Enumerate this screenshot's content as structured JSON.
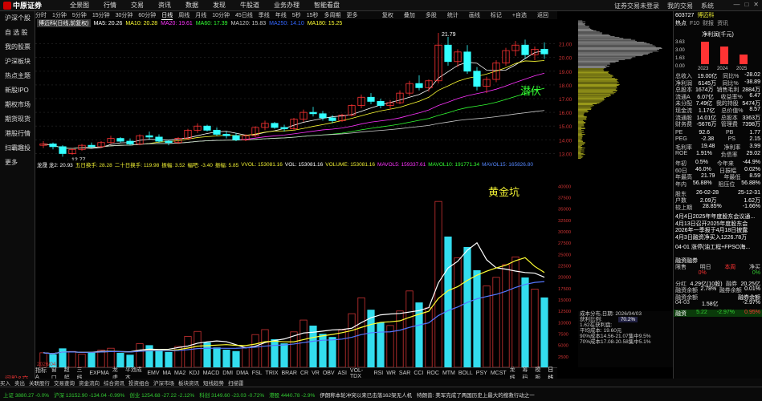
{
  "app": {
    "brand": "中原证券",
    "menu": [
      "全景图",
      "行情",
      "交易",
      "资讯",
      "数据",
      "发现",
      "牛股道",
      "业务办理",
      "智能看盘"
    ],
    "right": [
      "证券交易未登录",
      "我的交易",
      "系统"
    ]
  },
  "sidebar": {
    "items": [
      "沪深个股",
      "自 选 股",
      "我的股票",
      "沪深板块",
      "热点主题",
      "新股IPO",
      "期权市场",
      "期货现货",
      "港股行情",
      "扫霸趣投",
      "更多"
    ],
    "bottom": "问股&交易"
  },
  "periods": {
    "items": [
      "分时",
      "1分钟",
      "5分钟",
      "15分钟",
      "30分钟",
      "60分钟",
      "日线",
      "周线",
      "月线",
      "10分钟",
      "45日线",
      "季线",
      "年线",
      "5秒",
      "15秒",
      "多周期",
      "更多"
    ],
    "active": "日线",
    "right": [
      "复权",
      "叠加",
      "多股",
      "统计",
      "画线",
      "标记",
      "+自选",
      "返回"
    ]
  },
  "title_chip": "博迈科(日线,前复权)",
  "ma": [
    {
      "label": "MA5: 20.26",
      "color": "#ffffff"
    },
    {
      "label": "MA10: 20.28",
      "color": "#ffff33"
    },
    {
      "label": "MA20: 19.61",
      "color": "#ff33ff"
    },
    {
      "label": "MA60: 17.39",
      "color": "#33ff33"
    },
    {
      "label": "MA120: 15.83",
      "color": "#cccccc"
    },
    {
      "label": "MA250: 14.10",
      "color": "#3366ff"
    },
    {
      "label": "MA180: 15.25",
      "color": "#ffff33"
    }
  ],
  "annotations": {
    "high": "21.79",
    "low": "12.77",
    "potential": "潜伏",
    "golden_pit": "黄金坑"
  },
  "price_axis": [
    "21.00",
    "20.00",
    "19.00",
    "18.00",
    "17.00",
    "16.00",
    "15.00",
    "14.00",
    "13.00"
  ],
  "vol_axis": [
    "40000",
    "37500",
    "35000",
    "32500",
    "30000",
    "27500",
    "25000",
    "22500",
    "20000",
    "17500",
    "15000",
    "12500",
    "10000",
    "7500",
    "5000",
    "2500"
  ],
  "vol_legend": [
    "VOL: 153081.16",
    "VOLUME: 153081.16",
    "MAVOL5: 159337.61",
    "MAVOL10: 191771.34",
    "MAVOL15: 165826.80"
  ],
  "vol_legend2": [
    "龙晟 龙2: 20.93",
    "五日换手: 28.28",
    "二十日换手: 119.98",
    "振幅: 3.52",
    "幅吧: -3.40",
    "振幅: 5.85",
    "VVOL: 153081.16"
  ],
  "date_label": "2026/04",
  "period_toggle": "日线",
  "indicators": [
    "指标A",
    "窗口",
    "超幅",
    "三线",
    "EXPMA",
    "龙虎",
    "平池成本",
    "EMV",
    "MA",
    "MA2",
    "KDJ",
    "MACD",
    "DMI",
    "DMA",
    "FSL",
    "TRIX",
    "BRAR",
    "CR",
    "VR",
    "OBV",
    "ASI",
    "VOL-TDX",
    "RSI",
    "WR",
    "SAR",
    "CCI",
    "ROC",
    "MTM",
    "BOLL",
    "PSY",
    "MCST",
    "龙线",
    "筹码",
    "模板"
  ],
  "profile_info": [
    "成本分布,日期: 2026/04/03",
    "获利比例:",
    "1.62在获利盘:",
    "平均成本: 19.60元",
    "90%成本14.56-21.07集中9.5%",
    "70%成本17.08-20.58集中5.1%"
  ],
  "profile_pct": "70.2%",
  "rp": {
    "code": "603727",
    "name": "博迈科",
    "tabs": [
      "热点",
      "F10",
      "财报",
      "资讯"
    ],
    "chart_title": "净利润(千元)",
    "chart_years": [
      "2023",
      "2024",
      "2025"
    ],
    "chart_axis": [
      "3.63",
      "3.00",
      "1.63",
      "0.00"
    ],
    "rows": [
      [
        "总收入",
        "19.00亿",
        "同比%",
        "-28.02"
      ],
      [
        "净利润",
        "6145万",
        "同比%",
        "-38.89"
      ],
      [
        "总股本",
        "1674万",
        "销售毛利",
        "2884万"
      ],
      [
        "流通A",
        "6.07亿",
        "收益率%",
        "6.47"
      ],
      [
        "未分配",
        "7.49亿",
        "我的持股",
        "5474万"
      ],
      [
        "现金流",
        "1.17亿",
        "总价值%",
        "8.57"
      ],
      [
        "流通股",
        "14.01亿",
        "总股本",
        "3363万"
      ],
      [
        "财务费",
        "-5676万",
        "管理费",
        "7398万"
      ]
    ],
    "rows2": [
      [
        "PE",
        "92.6",
        "PB",
        "1.77"
      ],
      [
        "PEG",
        "-2.38",
        "PS",
        "2.15"
      ],
      [
        "毛利率",
        "19.48",
        "净利率",
        "3.99"
      ],
      [
        "ROE",
        "1.91%",
        "负债率",
        "29.02"
      ]
    ],
    "rows3": [
      [
        "年初",
        "0.5%",
        "今年来",
        "-44.9%"
      ],
      [
        "60日",
        "46.0%",
        "日振幅",
        "0.02%"
      ],
      [
        "年最高",
        "21.79",
        "年最低",
        "8.59"
      ],
      [
        "年内",
        "56.88%",
        "阻压位",
        "56.88%"
      ]
    ],
    "rows4": [
      [
        "股东",
        "26-02-28",
        "",
        "25-12-31"
      ],
      [
        "户数",
        "2.09万",
        "",
        "1.62万"
      ],
      [
        "较上期",
        "28.85%",
        "",
        "-1.66%"
      ]
    ],
    "news": [
      "4月4日2025年年度股东会议通...",
      "4月13日召开2025年度股东会",
      "2026年一季报于4月18日披露",
      "4月3日融资净买入1226.78万"
    ],
    "news2": [
      "04-01 涨停(油工程+FPSO海...",
      "",
      "融资融券"
    ],
    "tabs2": [
      "限售",
      "明日",
      "本周",
      "净买"
    ],
    "quote_rows": [
      [
        "",
        "0%",
        "",
        "0%"
      ]
    ],
    "bottom_rows": [
      [
        "分红",
        "4.29亿(10股)",
        "融券",
        "20.25亿"
      ],
      [
        "融资余额",
        "2.78%",
        "融券余额",
        "0.01%"
      ],
      [
        "融资余额",
        "",
        "",
        "融券余额"
      ],
      [
        "04-03",
        "1.58亿",
        "",
        "-2.97%"
      ]
    ],
    "last": {
      "label": "融资",
      "val": "5.22",
      "chg": "-2.97%",
      "tail": "0.95%"
    }
  },
  "botrow": [
    "买入",
    "卖出",
    "关联股行",
    "交易查询",
    "资金流向",
    "综合资讯",
    "投资组合",
    "沪深市场",
    "板块资讯",
    "短线趋势",
    "扫描雷"
  ],
  "status": [
    "上证 3880.27 -0.0%",
    "沪深 13152.90 -134.04 -0.99%",
    "创业 1254.68 -27.22 -2.12%",
    "科创 3149.60 -23.03 -0.72%",
    "港股 4440.78 -2.9%",
    "伊朗称本轮冲突以来已击落162架无人机",
    "特朗普: 美军完成了两国历史上最大的搜救行动之一"
  ],
  "chart_data": [
    {
      "type": "candlestick",
      "title": "博迈科(日线,前复权)",
      "ylim": [
        12.5,
        22.2
      ],
      "annotations": [
        {
          "text": "21.79"
        },
        {
          "text": "12.77"
        }
      ],
      "candles": [
        [
          13.6,
          13.9,
          13.4,
          13.7
        ],
        [
          13.7,
          13.8,
          13.3,
          13.5
        ],
        [
          13.5,
          13.6,
          12.77,
          13.0
        ],
        [
          13.0,
          13.4,
          12.9,
          13.3
        ],
        [
          13.3,
          13.7,
          13.2,
          13.6
        ],
        [
          13.6,
          13.8,
          13.4,
          13.5
        ],
        [
          13.5,
          13.9,
          13.4,
          13.8
        ],
        [
          13.8,
          14.3,
          13.7,
          14.1
        ],
        [
          14.1,
          14.2,
          13.8,
          13.9
        ],
        [
          13.9,
          14.1,
          13.6,
          13.7
        ],
        [
          13.7,
          14.4,
          13.6,
          14.3
        ],
        [
          14.3,
          14.6,
          14.0,
          14.2
        ],
        [
          14.2,
          14.4,
          13.8,
          13.9
        ],
        [
          13.9,
          14.0,
          13.6,
          13.8
        ],
        [
          13.8,
          14.2,
          13.7,
          14.1
        ],
        [
          14.1,
          14.8,
          14.0,
          14.7
        ],
        [
          14.7,
          15.2,
          14.5,
          15.0
        ],
        [
          15.0,
          15.1,
          14.6,
          14.7
        ],
        [
          14.7,
          14.9,
          14.3,
          14.4
        ],
        [
          14.4,
          14.6,
          14.1,
          14.3
        ],
        [
          14.3,
          14.5,
          13.9,
          14.0
        ],
        [
          14.0,
          14.4,
          13.9,
          14.3
        ],
        [
          14.3,
          15.0,
          14.2,
          14.9
        ],
        [
          14.9,
          15.4,
          14.7,
          15.2
        ],
        [
          15.2,
          15.3,
          14.8,
          14.9
        ],
        [
          14.9,
          15.1,
          14.6,
          14.8
        ],
        [
          14.8,
          15.6,
          14.7,
          15.5
        ],
        [
          15.5,
          16.2,
          15.3,
          16.0
        ],
        [
          16.0,
          16.4,
          15.7,
          15.9
        ],
        [
          15.9,
          16.1,
          15.4,
          15.6
        ],
        [
          15.6,
          15.8,
          15.2,
          15.4
        ],
        [
          15.4,
          15.9,
          15.3,
          15.8
        ],
        [
          15.8,
          16.6,
          15.7,
          16.5
        ],
        [
          16.5,
          17.3,
          16.3,
          17.1
        ],
        [
          17.1,
          17.4,
          16.6,
          16.8
        ],
        [
          16.8,
          17.0,
          16.3,
          16.5
        ],
        [
          16.5,
          16.9,
          16.2,
          16.7
        ],
        [
          16.7,
          17.6,
          16.6,
          17.4
        ],
        [
          17.4,
          18.3,
          17.2,
          18.1
        ],
        [
          18.1,
          18.7,
          17.6,
          17.8
        ],
        [
          17.8,
          18.4,
          17.5,
          18.3
        ],
        [
          18.3,
          21.79,
          18.1,
          20.9
        ],
        [
          20.9,
          21.5,
          19.4,
          19.7
        ],
        [
          19.7,
          20.6,
          19.3,
          20.4
        ],
        [
          20.4,
          20.9,
          18.8,
          19.0
        ],
        [
          19.0,
          19.3,
          17.6,
          17.9
        ],
        [
          17.9,
          18.6,
          17.4,
          18.4
        ],
        [
          18.4,
          19.8,
          18.2,
          19.6
        ],
        [
          19.6,
          20.7,
          19.4,
          20.5
        ],
        [
          20.5,
          21.2,
          20.1,
          20.9
        ],
        [
          20.9,
          21.3,
          19.9,
          20.2
        ],
        [
          20.2,
          20.8,
          19.8,
          20.6
        ],
        [
          20.6,
          21.1,
          19.9,
          20.26
        ]
      ]
    },
    {
      "type": "bar",
      "title": "VOL",
      "ylim": [
        0,
        42000
      ],
      "values": [
        3200,
        2800,
        4100,
        3500,
        2900,
        3300,
        3800,
        4200,
        3100,
        2700,
        5200,
        4800,
        3900,
        3300,
        4600,
        6800,
        7900,
        5400,
        4300,
        3800,
        3500,
        4400,
        7200,
        8300,
        6100,
        5200,
        7800,
        10400,
        9100,
        7300,
        6600,
        8200,
        11800,
        15300,
        12600,
        9800,
        9200,
        12400,
        16800,
        14200,
        13100,
        36500,
        28700,
        24100,
        26400,
        21300,
        17900,
        19800,
        22600,
        24300,
        19700,
        17200,
        15300
      ]
    }
  ]
}
